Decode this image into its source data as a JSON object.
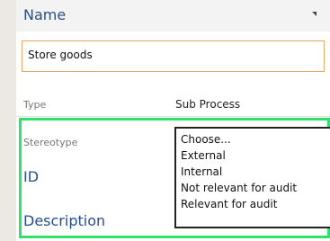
{
  "name_section": {
    "title": "Name",
    "value": "Store goods"
  },
  "type": {
    "label": "Type",
    "value": "Sub Process"
  },
  "stereotype": {
    "label": "Stereotype",
    "options": [
      "Choose...",
      "External",
      "Internal",
      "Not relevant for audit",
      "Relevant for audit"
    ]
  },
  "id": {
    "label": "ID"
  },
  "description": {
    "label": "Description"
  },
  "colors": {
    "highlight": "#2fe26b",
    "input_border": "#e9a765",
    "heading": "#27508a"
  },
  "icons": {
    "corner": "expand-arrow-icon"
  }
}
